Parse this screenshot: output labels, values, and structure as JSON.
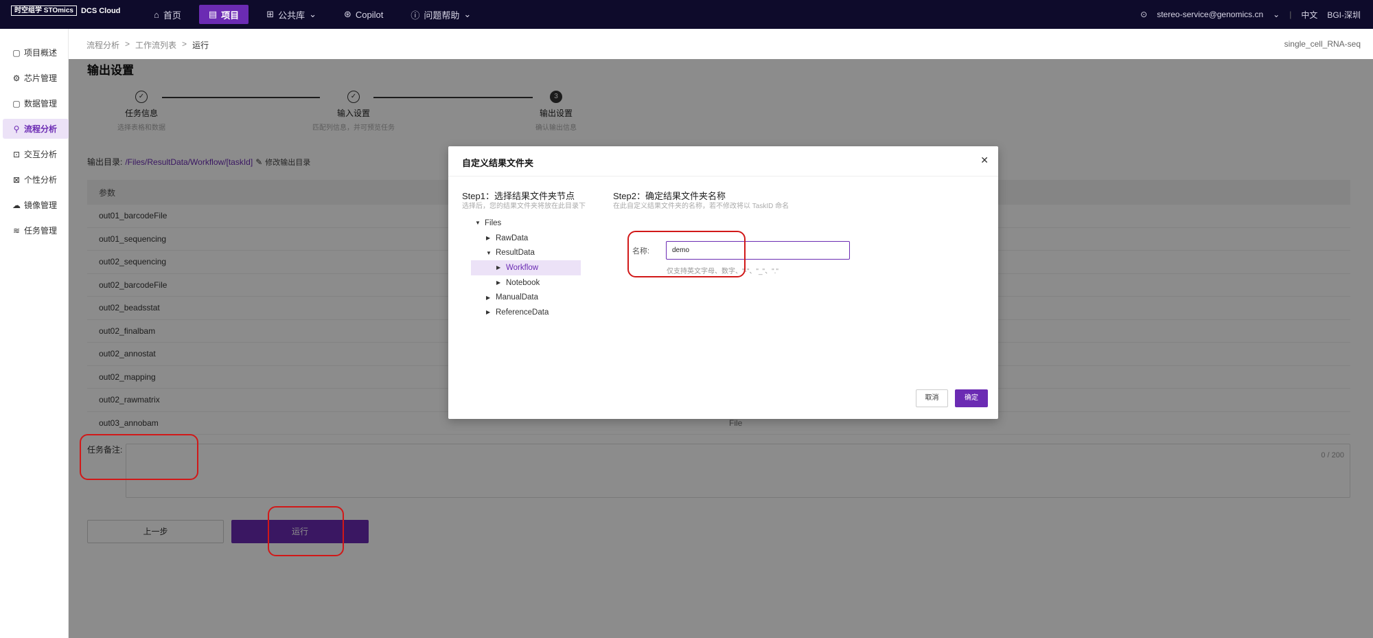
{
  "header": {
    "logo_text": "时空组学 STOmics",
    "logo_sub": "DCS Cloud",
    "nav": [
      {
        "label": "首页",
        "icon": "home-icon"
      },
      {
        "label": "项目",
        "icon": "file-icon"
      },
      {
        "label": "公共库",
        "icon": "grid-icon"
      },
      {
        "label": "Copilot",
        "icon": "copilot-icon"
      },
      {
        "label": "问题帮助",
        "icon": "help-icon"
      }
    ],
    "user": "stereo-service@genomics.cn",
    "language": "中文",
    "region": "BGI-深圳"
  },
  "sidebar": {
    "items": [
      {
        "label": "项目概述",
        "icon": "doc-icon"
      },
      {
        "label": "芯片管理",
        "icon": "chip-icon"
      },
      {
        "label": "数据管理",
        "icon": "data-icon"
      },
      {
        "label": "流程分析",
        "icon": "flow-icon"
      },
      {
        "label": "交互分析",
        "icon": "interact-icon"
      },
      {
        "label": "个性分析",
        "icon": "custom-icon"
      },
      {
        "label": "镜像管理",
        "icon": "image-icon"
      },
      {
        "label": "任务管理",
        "icon": "task-icon"
      }
    ]
  },
  "breadcrumb": [
    "流程分析",
    "工作流列表",
    "运行"
  ],
  "flow_name": "single_cell_RNA-seq",
  "section_title": "输出设置",
  "steps": [
    {
      "title": "任务信息",
      "desc": "选择表格和数据",
      "mark": "✓"
    },
    {
      "title": "输入设置",
      "desc": "匹配列信息，并可预览任务",
      "mark": "✓"
    },
    {
      "title": "输出设置",
      "desc": "确认输出信息",
      "mark": "3"
    }
  ],
  "output_dir": {
    "label": "输出目录:",
    "path": "/Files/ResultData/Workflow/[taskId]",
    "edit": "修改输出目录"
  },
  "table": {
    "header": "参数",
    "rows": [
      "out01_barcodeFile",
      "out01_sequencing",
      "out02_sequencing",
      "out02_barcodeFile",
      "out02_beadsstat",
      "out02_finalbam",
      "out02_annostat",
      "out02_mapping",
      "out02_rawmatrix",
      "out03_annobam"
    ],
    "last_type": "File"
  },
  "remark": {
    "label": "任务备注:",
    "count": "0 / 200"
  },
  "buttons": {
    "prev": "上一步",
    "run": "运行"
  },
  "modal": {
    "title": "自定义结果文件夹",
    "step1_title": "Step1：选择结果文件夹节点",
    "step1_desc": "选择后，您的结果文件夹将放在此目录下",
    "step2_title": "Step2：确定结果文件夹名称",
    "step2_desc": "在此自定义结果文件夹的名称，若不修改将以 TaskID 命名",
    "tree": [
      {
        "label": "Files",
        "level": 0,
        "caret": "▼"
      },
      {
        "label": "RawData",
        "level": 1,
        "caret": "▶"
      },
      {
        "label": "ResultData",
        "level": 1,
        "caret": "▼"
      },
      {
        "label": "Workflow",
        "level": 2,
        "caret": "▶",
        "selected": true
      },
      {
        "label": "Notebook",
        "level": 2,
        "caret": "▶"
      },
      {
        "label": "ManualData",
        "level": 1,
        "caret": "▶"
      },
      {
        "label": "ReferenceData",
        "level": 1,
        "caret": "▶"
      }
    ],
    "name_label": "名称:",
    "name_value": "demo",
    "name_hint": "仅支持英文字母、数字、\"-\"、\"_\"、\".\"",
    "cancel": "取消",
    "ok": "确定"
  },
  "colors": {
    "brand": "#6b2bb3",
    "topbar": "#0e0b2b",
    "annotation": "#d11818"
  }
}
